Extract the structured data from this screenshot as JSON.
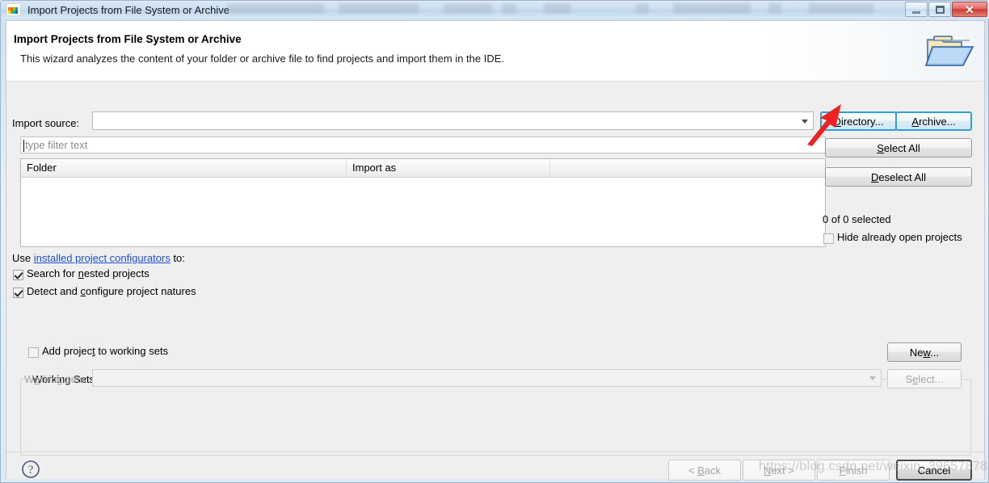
{
  "window": {
    "title": "Import Projects from File System or Archive",
    "app_icon": "nxp-logo-icon",
    "controls": {
      "minimize": "minimize-icon",
      "maximize": "maximize-icon",
      "close": "✕"
    }
  },
  "header": {
    "title": "Import Projects from File System or Archive",
    "subtitle": "This wizard analyzes the content of your folder or archive file to find projects and import them in the IDE.",
    "icon": "open-folder-icon"
  },
  "form": {
    "import_source_label": "Import source:",
    "import_source_value": "",
    "import_source_placeholder": "",
    "directory_button": {
      "pre": "",
      "mnemonic": "D",
      "post": "irectory..."
    },
    "archive_button": {
      "pre": "",
      "mnemonic": "A",
      "post": "rchive..."
    },
    "filter_placeholder": "type filter text",
    "filter_value": ""
  },
  "table": {
    "columns": [
      "Folder",
      "Import as",
      ""
    ],
    "rows": []
  },
  "side": {
    "select_all": {
      "pre": "",
      "mnemonic": "S",
      "post": "elect All"
    },
    "deselect_all": {
      "pre": "",
      "mnemonic": "D",
      "post": "eselect All"
    },
    "selection_status": "0 of 0 selected",
    "hide_open_projects_label": "Hide already open projects",
    "hide_open_projects_checked": false
  },
  "configurators": {
    "prefix": "Use ",
    "link": "installed project configurators",
    "suffix": " to:",
    "options": [
      {
        "pre": "Search for ",
        "mnemonic": "n",
        "post": "ested projects",
        "checked": true
      },
      {
        "pre": "Detect and ",
        "mnemonic": "c",
        "post": "onfigure project natures",
        "checked": true
      }
    ]
  },
  "working_sets": {
    "group_label": "Working Sets",
    "add_checkbox_label": {
      "pre": "Add projec",
      "mnemonic": "t",
      "post": " to working sets"
    },
    "add_checked": false,
    "sets_label": {
      "pre": "W",
      "mnemonic": "o",
      "post": "rking sets:"
    },
    "sets_value": "",
    "new_button": {
      "pre": "Ne",
      "mnemonic": "w",
      "post": "..."
    },
    "select_button": {
      "pre": "S",
      "mnemonic": "e",
      "post": "lect..."
    }
  },
  "footer": {
    "help": "help-icon",
    "back": {
      "pre": "< ",
      "mnemonic": "B",
      "post": "ack"
    },
    "next": {
      "pre": "",
      "mnemonic": "N",
      "post": "ext >"
    },
    "finish": {
      "pre": "",
      "mnemonic": "F",
      "post": "inish"
    },
    "cancel": "Cancel"
  },
  "annotation": {
    "arrow_color": "#ee2222",
    "watermark": "https://blog.csdn.net/weixin_39657878"
  },
  "colors": {
    "link": "#1f4fd8",
    "focus_border": "#2f9fe0",
    "accent_red": "#ee2222"
  }
}
